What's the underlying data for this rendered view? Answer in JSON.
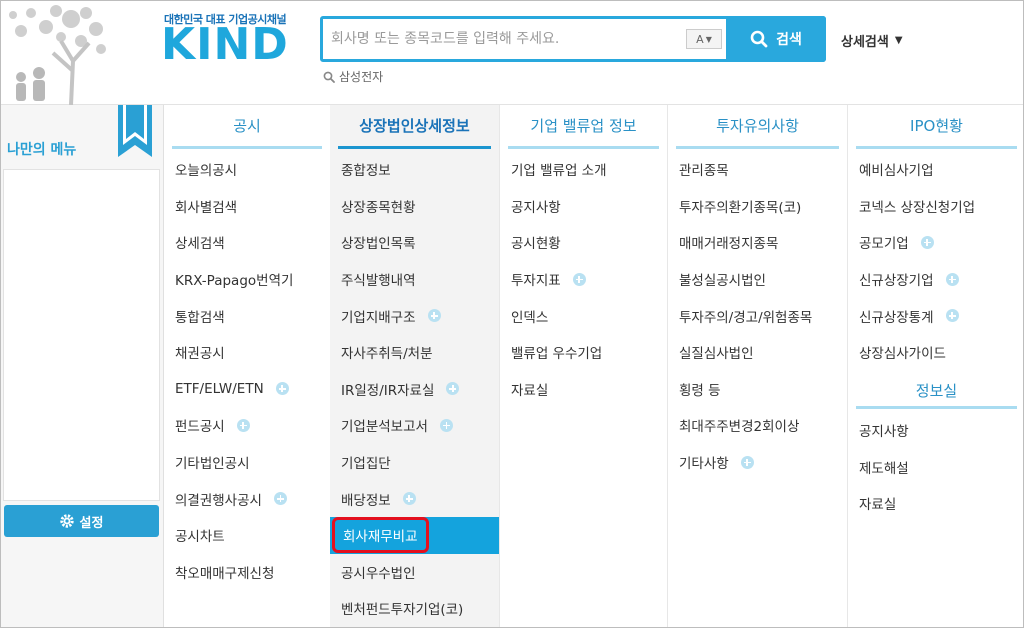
{
  "header": {
    "logo_tagline": "대한민국 대표 기업공시채널",
    "logo_text": "KIND",
    "search_placeholder": "회사명 또는 종목코드를 입력해 주세요.",
    "font_size_label": "A",
    "search_button_label": "검색",
    "advanced_search_label": "상세검색",
    "recent_search": "삼성전자"
  },
  "mymenu": {
    "title": "나만의 메뉴",
    "setting_label": "설정"
  },
  "columns": [
    {
      "title": "공시",
      "items": [
        {
          "label": "오늘의공시",
          "plus": false
        },
        {
          "label": "회사별검색",
          "plus": false
        },
        {
          "label": "상세검색",
          "plus": false
        },
        {
          "label": "KRX-Papago번역기",
          "plus": false
        },
        {
          "label": "통합검색",
          "plus": false
        },
        {
          "label": "채권공시",
          "plus": false
        },
        {
          "label": "ETF/ELW/ETN",
          "plus": true
        },
        {
          "label": "펀드공시",
          "plus": true
        },
        {
          "label": "기타법인공시",
          "plus": false
        },
        {
          "label": "의결권행사공시",
          "plus": true
        },
        {
          "label": "공시차트",
          "plus": false
        },
        {
          "label": "착오매매구제신청",
          "plus": false
        }
      ]
    },
    {
      "title": "상장법인상세정보",
      "items": [
        {
          "label": "종합정보",
          "plus": false
        },
        {
          "label": "상장종목현황",
          "plus": false
        },
        {
          "label": "상장법인목록",
          "plus": false
        },
        {
          "label": "주식발행내역",
          "plus": false
        },
        {
          "label": "기업지배구조",
          "plus": true
        },
        {
          "label": "자사주취득/처분",
          "plus": false
        },
        {
          "label": "IR일정/IR자료실",
          "plus": true
        },
        {
          "label": "기업분석보고서",
          "plus": true
        },
        {
          "label": "기업집단",
          "plus": false
        },
        {
          "label": "배당정보",
          "plus": true
        },
        {
          "label": "회사재무비교",
          "plus": false,
          "active": true
        },
        {
          "label": "공시우수법인",
          "plus": false
        },
        {
          "label": "벤처펀드투자기업(코)",
          "plus": false
        }
      ]
    },
    {
      "title": "기업 밸류업 정보",
      "items": [
        {
          "label": "기업 밸류업 소개",
          "plus": false
        },
        {
          "label": "공지사항",
          "plus": false
        },
        {
          "label": "공시현황",
          "plus": false
        },
        {
          "label": "투자지표",
          "plus": true
        },
        {
          "label": "인덱스",
          "plus": false
        },
        {
          "label": "밸류업 우수기업",
          "plus": false
        },
        {
          "label": "자료실",
          "plus": false
        }
      ]
    },
    {
      "title": "투자유의사항",
      "items": [
        {
          "label": "관리종목",
          "plus": false
        },
        {
          "label": "투자주의환기종목(코)",
          "plus": false
        },
        {
          "label": "매매거래정지종목",
          "plus": false
        },
        {
          "label": "불성실공시법인",
          "plus": false
        },
        {
          "label": "투자주의/경고/위험종목",
          "plus": false
        },
        {
          "label": "실질심사법인",
          "plus": false
        },
        {
          "label": "횡령 등",
          "plus": false
        },
        {
          "label": "최대주주변경2회이상",
          "plus": false
        },
        {
          "label": "기타사항",
          "plus": true
        }
      ]
    },
    {
      "title": "IPO현황",
      "items": [
        {
          "label": "예비심사기업",
          "plus": false
        },
        {
          "label": "코넥스 상장신청기업",
          "plus": false
        },
        {
          "label": "공모기업",
          "plus": true
        },
        {
          "label": "신규상장기업",
          "plus": true
        },
        {
          "label": "신규상장통계",
          "plus": true
        },
        {
          "label": "상장심사가이드",
          "plus": false
        }
      ],
      "subsection": {
        "title": "정보실",
        "items": [
          {
            "label": "공지사항",
            "plus": false
          },
          {
            "label": "제도해설",
            "plus": false
          },
          {
            "label": "자료실",
            "plus": false
          }
        ]
      }
    }
  ],
  "colors": {
    "accent": "#29a8dd",
    "active_bg": "#14a3dd",
    "highlight_border": "#e3101e"
  }
}
